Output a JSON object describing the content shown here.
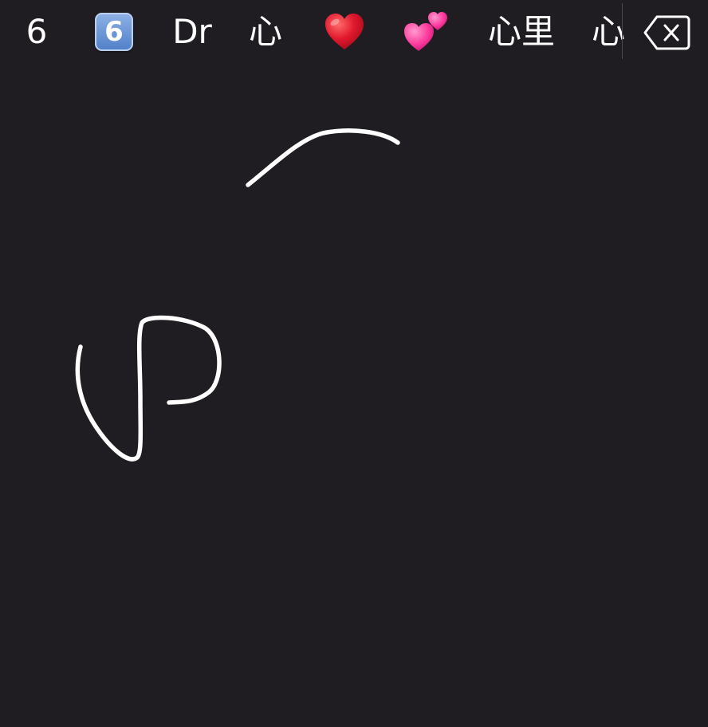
{
  "candidates": [
    {
      "text": "6",
      "kind": "text",
      "icon": null
    },
    {
      "text": "6",
      "kind": "emoji",
      "icon": "keycap-digit-six-emoji"
    },
    {
      "text": "Dr",
      "kind": "text",
      "icon": null
    },
    {
      "text": "心",
      "kind": "text",
      "icon": null
    },
    {
      "text": "❤️",
      "kind": "emoji",
      "icon": "red-heart-emoji"
    },
    {
      "text": "💕",
      "kind": "emoji",
      "icon": "two-hearts-emoji"
    },
    {
      "text": "心里",
      "kind": "text",
      "icon": null
    },
    {
      "text": "心",
      "kind": "text",
      "icon": null
    }
  ],
  "delete_key": {
    "icon": "backspace-icon"
  },
  "colors": {
    "background": "#1f1d21",
    "text": "#ffffff",
    "stroke": "#ffffff",
    "keycap": "#5b8ad0",
    "heart": "#e0182d",
    "pink_heart": "#ff4fa8"
  },
  "handwriting": {
    "description_icon": "handwriting-strokes"
  }
}
